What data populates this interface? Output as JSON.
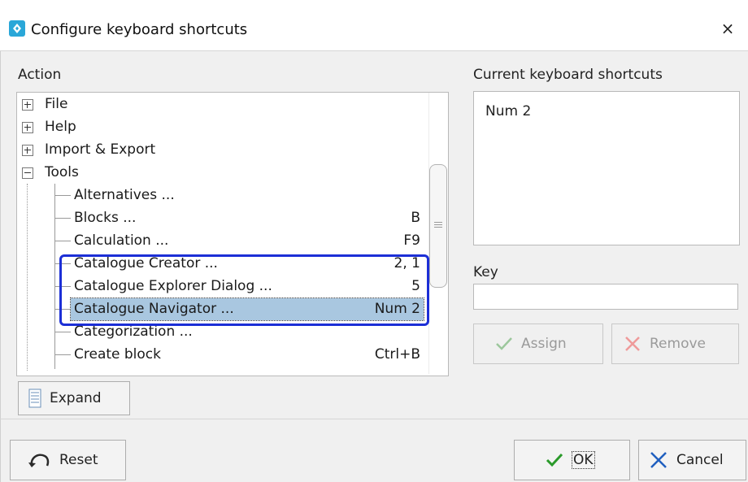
{
  "window": {
    "title": "Configure keyboard shortcuts",
    "close_glyph": "×"
  },
  "action_panel": {
    "label": "Action",
    "tree": [
      {
        "label": "File",
        "expander": "plus"
      },
      {
        "label": "Help",
        "expander": "plus"
      },
      {
        "label": "Import & Export",
        "expander": "plus"
      },
      {
        "label": "Tools",
        "expander": "minus"
      },
      {
        "label": "Alternatives ...",
        "shortcut": ""
      },
      {
        "label": "Blocks ...",
        "shortcut": "B"
      },
      {
        "label": "Calculation ...",
        "shortcut": "F9"
      },
      {
        "label": "Catalogue Creator ...",
        "shortcut": "2, 1"
      },
      {
        "label": "Catalogue Explorer Dialog ...",
        "shortcut": "5"
      },
      {
        "label": "Catalogue Navigator ...",
        "shortcut": "Num 2",
        "selected": true
      },
      {
        "label": "Categorization ...",
        "shortcut": ""
      },
      {
        "label": "Create block",
        "shortcut": "Ctrl+B"
      }
    ],
    "expand_button": "Expand"
  },
  "shortcuts_panel": {
    "label": "Current keyboard shortcuts",
    "items": [
      "Num 2"
    ],
    "key_label": "Key",
    "key_value": "",
    "assign_button": "Assign",
    "remove_button": "Remove"
  },
  "footer": {
    "reset_button": "Reset",
    "ok_button": "OK",
    "cancel_button": "Cancel"
  },
  "colors": {
    "selection": "#a9c7e0",
    "highlight_border": "#1c2fd6",
    "check_green": "#2a9a2a",
    "remove_red": "#e05050",
    "cancel_blue": "#1f5fbf"
  }
}
